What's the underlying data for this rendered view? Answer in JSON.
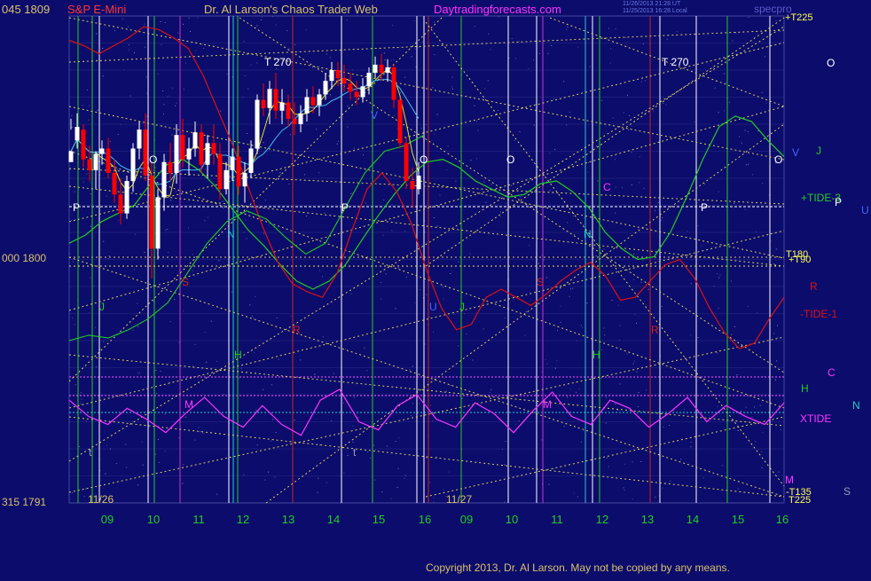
{
  "header": {
    "left_prices": "045  1809",
    "instrument": "S&P E-Mini",
    "site_title": "Dr. Al Larson's Chaos Trader Web",
    "site_url": "Daytradingforecasts.com",
    "timestamp_1": "11/26/2013 21:28 UT",
    "timestamp_2": "11/25/2013 16:28 Local",
    "top_right": "specpro"
  },
  "copyright": "Copyright 2013, Dr. Al Larson. May not be copied by any means.",
  "colors": {
    "background": "#0c0c6c",
    "grid": "#4646a0",
    "price_bull": "#ffffff",
    "price_bear": "#ff0000",
    "tide_green": "#22cc22",
    "tide_red": "#dd1111",
    "xtide": "#ff33ff",
    "fan_lines": "#e8e060"
  },
  "chart_data": {
    "type": "line",
    "title": "S&P E-Mini",
    "ylim": [
      1791,
      1809
    ],
    "y_ticks": [
      {
        "label": "045  1809",
        "value": 1809
      },
      {
        "label": "000  1800",
        "value": 1800
      },
      {
        "label": "315  1791",
        "value": 1791
      }
    ],
    "x_day_labels": [
      "11/26",
      "11/27"
    ],
    "x_ticks": [
      "09",
      "10",
      "11",
      "12",
      "13",
      "14",
      "15",
      "16",
      "09",
      "10",
      "11",
      "12",
      "13",
      "14",
      "15",
      "16"
    ],
    "price_bars": [
      [
        0,
        1803.6,
        1805.2,
        1804.8,
        1804.0
      ],
      [
        1,
        1804.4,
        1805.4,
        1804.1,
        1804.9
      ],
      [
        2,
        1804.8,
        1805.0,
        1803.4,
        1803.7
      ],
      [
        3,
        1803.7,
        1804.2,
        1802.9,
        1803.3
      ],
      [
        4,
        1803.3,
        1804.0,
        1802.6,
        1803.9
      ],
      [
        5,
        1803.9,
        1804.4,
        1803.5,
        1804.1
      ],
      [
        6,
        1804.1,
        1804.5,
        1803.0,
        1803.2
      ],
      [
        7,
        1803.2,
        1803.7,
        1802.1,
        1802.4
      ],
      [
        8,
        1802.4,
        1803.0,
        1801.3,
        1801.7
      ],
      [
        9,
        1801.7,
        1803.1,
        1801.5,
        1802.9
      ],
      [
        10,
        1802.9,
        1804.3,
        1802.5,
        1804.1
      ],
      [
        11,
        1804.1,
        1805.1,
        1803.7,
        1804.8
      ],
      [
        12,
        1804.8,
        1805.4,
        1802.9,
        1803.1
      ],
      [
        13,
        1803.1,
        1803.6,
        1799.3,
        1800.4
      ],
      [
        14,
        1800.4,
        1802.6,
        1800.0,
        1802.3
      ],
      [
        15,
        1802.3,
        1803.9,
        1801.8,
        1803.6
      ],
      [
        16,
        1803.6,
        1804.3,
        1802.9,
        1803.2
      ],
      [
        17,
        1803.2,
        1805.0,
        1802.8,
        1804.6
      ],
      [
        18,
        1804.6,
        1805.2,
        1803.4,
        1803.7
      ],
      [
        19,
        1803.7,
        1804.5,
        1803.1,
        1804.1
      ],
      [
        20,
        1804.1,
        1805.1,
        1803.8,
        1804.7
      ],
      [
        21,
        1804.7,
        1805.0,
        1803.2,
        1803.5
      ],
      [
        22,
        1803.5,
        1804.6,
        1803.0,
        1804.3
      ],
      [
        23,
        1804.3,
        1805.0,
        1803.5,
        1803.9
      ],
      [
        24,
        1803.9,
        1804.3,
        1802.2,
        1802.6
      ],
      [
        25,
        1802.6,
        1803.6,
        1802.4,
        1803.3
      ],
      [
        26,
        1803.3,
        1804.1,
        1802.9,
        1803.8
      ],
      [
        27,
        1803.8,
        1804.2,
        1802.4,
        1802.7
      ],
      [
        28,
        1802.7,
        1803.6,
        1802.1,
        1803.2
      ],
      [
        29,
        1803.2,
        1804.4,
        1803.0,
        1804.1
      ],
      [
        30,
        1804.1,
        1806.1,
        1803.9,
        1805.9
      ],
      [
        31,
        1805.9,
        1806.5,
        1805.3,
        1805.6
      ],
      [
        32,
        1805.6,
        1806.6,
        1805.0,
        1806.3
      ],
      [
        33,
        1806.3,
        1806.9,
        1805.2,
        1805.5
      ],
      [
        34,
        1805.5,
        1806.3,
        1805.0,
        1805.8
      ],
      [
        35,
        1805.8,
        1806.1,
        1804.9,
        1805.2
      ],
      [
        36,
        1805.2,
        1805.8,
        1804.6,
        1805.0
      ],
      [
        37,
        1805.0,
        1805.7,
        1804.7,
        1805.4
      ],
      [
        38,
        1805.4,
        1806.3,
        1805.1,
        1806.0
      ],
      [
        39,
        1806.0,
        1806.4,
        1805.4,
        1805.7
      ],
      [
        40,
        1805.7,
        1806.3,
        1805.3,
        1806.1
      ],
      [
        41,
        1806.1,
        1806.9,
        1805.9,
        1806.6
      ],
      [
        42,
        1806.6,
        1807.3,
        1806.3,
        1807.0
      ],
      [
        43,
        1807.0,
        1807.3,
        1806.4,
        1806.7
      ],
      [
        44,
        1806.7,
        1807.2,
        1806.2,
        1806.5
      ],
      [
        45,
        1806.5,
        1806.9,
        1805.9,
        1806.2
      ],
      [
        46,
        1806.2,
        1806.6,
        1805.7,
        1806.0
      ],
      [
        47,
        1806.0,
        1806.7,
        1805.8,
        1806.4
      ],
      [
        48,
        1806.4,
        1807.1,
        1806.1,
        1806.9
      ],
      [
        49,
        1806.9,
        1807.5,
        1806.7,
        1807.2
      ],
      [
        50,
        1807.2,
        1807.6,
        1806.6,
        1806.9
      ],
      [
        51,
        1806.9,
        1807.4,
        1806.6,
        1807.1
      ],
      [
        52,
        1807.1,
        1807.2,
        1805.6,
        1805.9
      ],
      [
        53,
        1805.9,
        1806.0,
        1804.1,
        1804.3
      ],
      [
        54,
        1804.3,
        1804.5,
        1802.6,
        1802.9
      ],
      [
        55,
        1802.9,
        1803.4,
        1801.9,
        1802.6
      ],
      [
        56,
        1802.6,
        1803.6,
        1802.4,
        1803.1
      ]
    ],
    "series": [
      {
        "name": "XTIDE",
        "values": [
          1794.8,
          1794.2,
          1793.9,
          1794.5,
          1794.1,
          1793.6,
          1794.3,
          1794.9,
          1794.2,
          1793.8,
          1794.6,
          1793.9,
          1793.5,
          1794.8,
          1795.2,
          1794.0,
          1793.7,
          1794.6,
          1795.0,
          1794.1,
          1793.8,
          1794.7,
          1794.3,
          1793.6,
          1794.4,
          1795.1,
          1794.2,
          1793.9,
          1794.8,
          1794.5,
          1793.8,
          1794.3,
          1794.9,
          1794.0,
          1794.6,
          1794.2,
          1793.9,
          1794.7
        ]
      },
      {
        "name": "+TIDE-3",
        "values": [
          1800.6,
          1800.9,
          1801.4,
          1801.7,
          1802.0,
          1802.8,
          1803.5,
          1803.7,
          1803.3,
          1802.7,
          1801.9,
          1801.1,
          1800.5,
          1799.8,
          1799.2,
          1798.9,
          1799.2,
          1799.8,
          1800.7,
          1801.6,
          1802.4,
          1803.1,
          1803.6,
          1803.7,
          1803.4,
          1802.9,
          1802.6,
          1802.3,
          1802.4,
          1802.8,
          1802.9,
          1802.5,
          1801.9,
          1801.0,
          1800.4,
          1800.0,
          1800.1,
          1801.0,
          1802.3,
          1803.7,
          1804.9,
          1805.3,
          1805.1,
          1804.4,
          1803.8
        ]
      },
      {
        "name": "-TIDE-1",
        "values": [
          1808.1,
          1807.9,
          1807.6,
          1807.9,
          1808.2,
          1808.6,
          1808.5,
          1808.2,
          1807.8,
          1806.8,
          1805.5,
          1804.2,
          1802.7,
          1801.2,
          1799.9,
          1799.1,
          1798.8,
          1798.6,
          1799.5,
          1801.1,
          1802.6,
          1803.2,
          1802.5,
          1801.3,
          1799.6,
          1798.2,
          1797.4,
          1797.6,
          1798.6,
          1798.9,
          1798.6,
          1798.3,
          1798.7,
          1799.2,
          1799.6,
          1799.9,
          1799.4,
          1798.5,
          1798.6,
          1799.2,
          1799.8,
          1800.0,
          1799.3,
          1798.2,
          1797.3,
          1796.7,
          1796.9,
          1797.8,
          1798.6
        ]
      }
    ],
    "legend_labels": [
      {
        "text": "O",
        "color": "#ffffff"
      },
      {
        "text": "V",
        "color": "#4466ff"
      },
      {
        "text": "J",
        "color": "#22cc22"
      },
      {
        "text": "+TIDE-3",
        "color": "#22cc22"
      },
      {
        "text": "P",
        "color": "#ffffff"
      },
      {
        "text": "U",
        "color": "#4466ff"
      },
      {
        "text": "R",
        "color": "#dd1111"
      },
      {
        "text": "-TIDE-1",
        "color": "#dd1111"
      },
      {
        "text": "C",
        "color": "#ff33ff"
      },
      {
        "text": "H",
        "color": "#22cc22"
      },
      {
        "text": "N",
        "color": "#22cccc"
      },
      {
        "text": "XTIDE",
        "color": "#ff33ff"
      },
      {
        "text": "M",
        "color": "#ff33ff"
      },
      {
        "text": "S",
        "color": "#9999bb"
      }
    ],
    "fan_labels": [
      "+T225",
      "T180",
      "+T90",
      "-T135",
      "T225"
    ],
    "chart_annotations": [
      "T  270",
      "T  270",
      "O",
      "O",
      "O",
      "O",
      "P",
      "P",
      "P",
      "N",
      "N",
      "S",
      "S",
      "H",
      "H",
      "J",
      "J",
      "M",
      "M",
      "t",
      "t",
      "R",
      "R",
      "C",
      "V",
      "U"
    ]
  }
}
